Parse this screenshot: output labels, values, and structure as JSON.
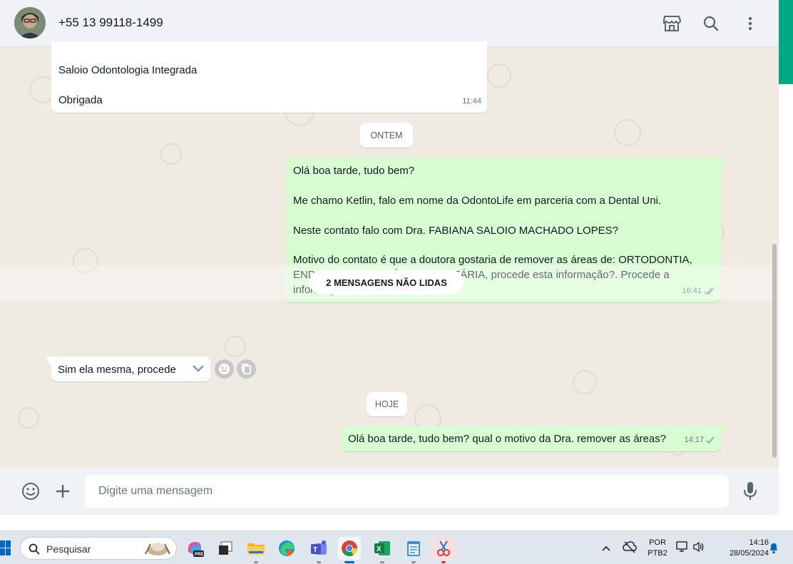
{
  "header": {
    "contact_name": "+55 13 99118-1499"
  },
  "messages": {
    "top_in_line1": "Saloio Odontologia Integrada",
    "top_in_line2": "Obrigada",
    "top_in_time": "11:44",
    "day_yesterday": "ONTEM",
    "out1": {
      "p1": "Olá boa tarde, tudo bem?",
      "p2": "Me chamo Ketlin, falo em nome da OdontoLife em parceria com a Dental Uni.",
      "p3": "Neste contato falo com Dra. FABIANA SALOIO MACHADO LOPES?",
      "p4": "Motivo do contato é que a doutora gostaria de remover as áreas de: ORTODONTIA, ENDODONTIA E  PRÓTESE DENTÁRIA, procede esta informação?. Procede a informação?",
      "time": "16:41"
    },
    "unread_label": "2 MENSAGENS NÃO LIDAS",
    "in2": {
      "text": "Sim ela mesma, procede",
      "time": "..."
    },
    "day_today": "HOJE",
    "out2": {
      "text": "Olá boa tarde, tudo bem? qual o motivo da Dra. remover as áreas?",
      "time": "14:17"
    }
  },
  "composer": {
    "placeholder": "Digite uma mensagem"
  },
  "taskbar": {
    "search_label": "Pesquisar",
    "lang_line1": "POR",
    "lang_line2": "PTB2",
    "clock_time": "14:16",
    "clock_date": "28/05/2024"
  },
  "colors": {
    "outgoing_bubble": "#d9fdd3",
    "incoming_bubble": "#ffffff",
    "accent": "#00a884"
  }
}
